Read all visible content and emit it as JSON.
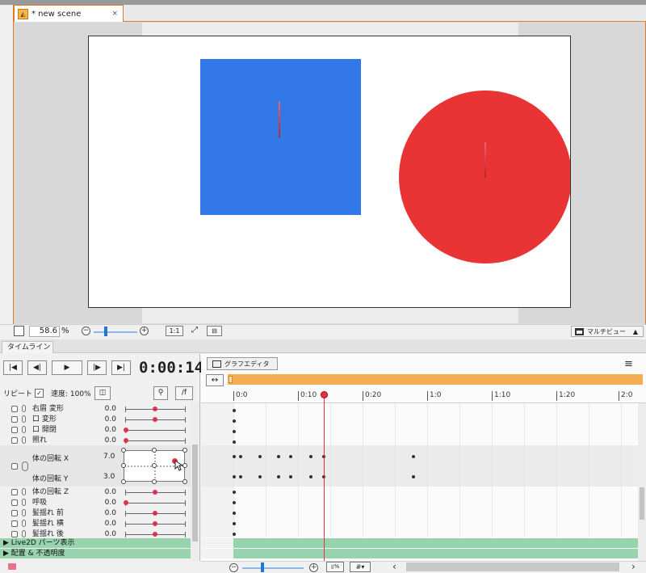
{
  "scene": {
    "tab_label": "* new scene",
    "close_glyph": "×",
    "shape_colors": {
      "blue": "#3278e8",
      "red": "#e83434"
    }
  },
  "scene_toolbar": {
    "zoom_value": "58.6",
    "zoom_unit": "%",
    "zoom_out_icon": "zoom-out-icon",
    "zoom_in_icon": "zoom-in-icon",
    "one_to_one_label": "1:1",
    "fit_icon": "fit-screen-icon",
    "guide_icon": "guide-icon",
    "multiview_label": "マルチビュー",
    "multiview_arrow": "▲"
  },
  "timeline": {
    "tab_label": "タイムライン",
    "timecode": "0:00:14",
    "repeat_label": "リピート",
    "repeat_checked": "✓",
    "speed_label": "速度: 100%",
    "fx_label": "/f",
    "graph_editor_label": "グラフエディタ",
    "menu_glyph": "≡",
    "range_glyph": "↔",
    "ruler_ticks": [
      "0:0",
      "0:10",
      "0:20",
      "1:0",
      "1:10",
      "1:20",
      "2:0"
    ],
    "params": [
      {
        "name": "右眉 変形",
        "value": "0.0"
      },
      {
        "name": "口 変形",
        "value": "0.0"
      },
      {
        "name": "口 開閉",
        "value": "0.0"
      },
      {
        "name": "照れ",
        "value": "0.0"
      },
      {
        "name": "体の回転 Z",
        "value": "0.0"
      },
      {
        "name": "呼吸",
        "value": "0.0"
      },
      {
        "name": "髪揺れ 前",
        "value": "0.0"
      },
      {
        "name": "髪揺れ 横",
        "value": "0.0"
      },
      {
        "name": "髪揺れ 後",
        "value": "0.0"
      }
    ],
    "xy_param": {
      "x_name": "体の回転 X",
      "x_value": "7.0",
      "y_name": "体の回転 Y",
      "y_value": "3.0"
    },
    "groups": [
      {
        "label": "▶ Live2D パーツ表示"
      },
      {
        "label": "▶ 配置 & 不透明度"
      }
    ],
    "playback_buttons": [
      "|◀",
      "◀|",
      "▶",
      "|▶",
      "▶|"
    ],
    "playhead_color": "#e0334a",
    "group_color": "#97d4ad"
  }
}
